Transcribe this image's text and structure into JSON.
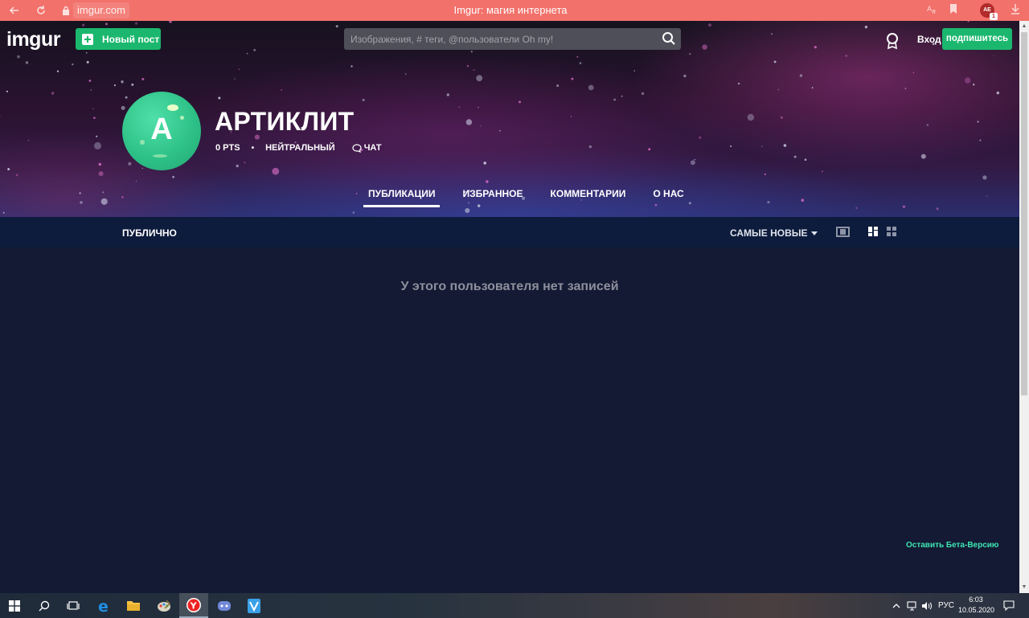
{
  "browser": {
    "url": "imgur.com",
    "title": "Imgur: магия интернета",
    "extension_badge": "1",
    "extension_label": "AE"
  },
  "header": {
    "logo": "imgur",
    "new_post": "Новый пост",
    "search_placeholder": "Изображения, # теги, @пользователи Oh my!",
    "login": "Вход",
    "signup": "подпишитесь"
  },
  "profile": {
    "avatar_letter": "A",
    "username": "АРТИКЛИТ",
    "points": "0 PTS",
    "separator": "•",
    "rank": "НЕЙТРАЛЬНЫЙ",
    "chat": "ЧАТ"
  },
  "tabs": [
    {
      "label": "ПУБЛИКАЦИИ",
      "active": true
    },
    {
      "label": "ИЗБРАННОЕ",
      "active": false
    },
    {
      "label": "КОММЕНТАРИИ",
      "active": false
    },
    {
      "label": "О НАС",
      "active": false
    }
  ],
  "subbar": {
    "visibility": "ПУБЛИЧНО",
    "sort": "САМЫЕ НОВЫЕ"
  },
  "content": {
    "empty_message": "У этого пользователя нет записей",
    "beta_link": "Оставить Бета-Версию"
  },
  "taskbar": {
    "language": "РУС",
    "time": "6:03",
    "date": "10.05.2020"
  },
  "colors": {
    "accent_green": "#1bb76e",
    "browser_bar": "#f2716b",
    "page_bg": "#141a33",
    "beta_link": "#3ee5b3"
  }
}
